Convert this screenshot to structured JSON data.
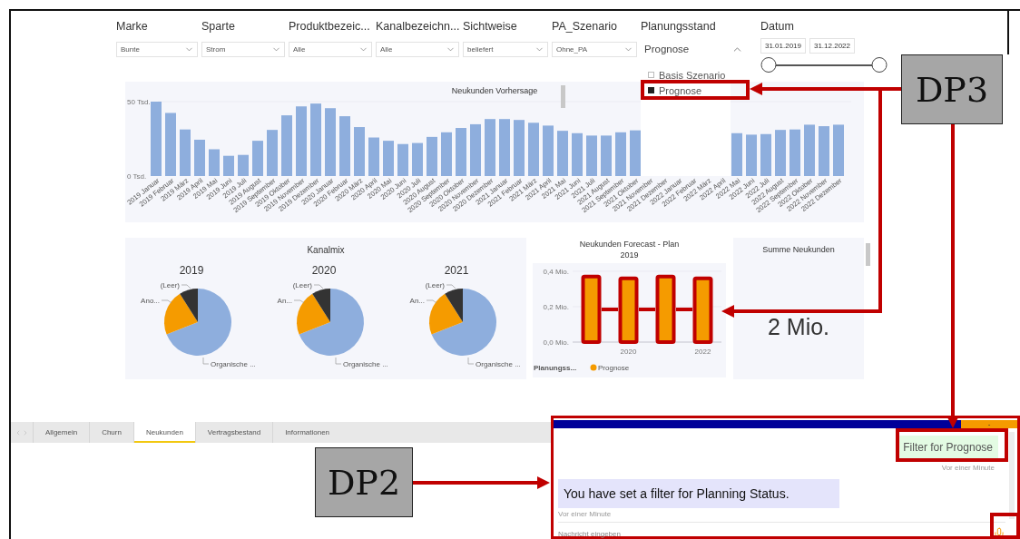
{
  "filters": [
    {
      "label": "Marke",
      "value": "Bunte"
    },
    {
      "label": "Sparte",
      "value": "Strom"
    },
    {
      "label": "Produktbezeic...",
      "value": "Alle"
    },
    {
      "label": "Kanalbezeichn...",
      "value": "Alle"
    },
    {
      "label": "Sichtweise",
      "value": "beliefert"
    },
    {
      "label": "PA_Szenario",
      "value": "Ohne_PA"
    }
  ],
  "planning_filter": {
    "label": "Planungsstand",
    "value": "Prognose",
    "expanded": true,
    "options": [
      {
        "label": "Basis Szenario",
        "checked": false
      },
      {
        "label": "Prognose",
        "checked": true
      }
    ]
  },
  "date_filter": {
    "label": "Datum",
    "start": "31.01.2019",
    "end": "31.12.2022",
    "thumbs": [
      {
        "level": 0
      },
      {
        "level": 1
      }
    ]
  },
  "trend_chart": {
    "chart_data": {
      "type": "bar",
      "title": "Neukunden Vorhersage",
      "categories": [
        "2019 Januar",
        "2019 Februar",
        "2019 März",
        "2019 April",
        "2019 Mai",
        "2019 Juni",
        "2019 Juli",
        "2019 August",
        "2019 September",
        "2019 Oktober",
        "2019 November",
        "2019 Dezember",
        "2020 Januar",
        "2020 Februar",
        "2020 März",
        "2020 April",
        "2020 Mai",
        "2020 Juni",
        "2020 Juli",
        "2020 August",
        "2020 September",
        "2020 Oktober",
        "2020 November",
        "2020 Dezember",
        "2021 Januar",
        "2021 Februar",
        "2021 März",
        "2021 April",
        "2021 Mai",
        "2021 Juni",
        "2021 Juli",
        "2021 August",
        "2021 September",
        "2021 Oktober",
        "2021 November",
        "2021 Dezember",
        "2022 Januar",
        "2022 Februar",
        "2022 März",
        "2022 April",
        "2022 Mai",
        "2022 Juni",
        "2022 Juli",
        "2022 August",
        "2022 September",
        "2022 Oktober",
        "2022 November",
        "2022 Dezember"
      ],
      "values": [
        50,
        42.4,
        31.3,
        24.4,
        18,
        13.6,
        14.2,
        23.7,
        31,
        40.8,
        46.8,
        48.7,
        45.6,
        40.2,
        32.9,
        25.9,
        23.7,
        21.5,
        22.2,
        26.3,
        29.4,
        32.3,
        34.8,
        38.3,
        38.3,
        37.7,
        35.8,
        33.9,
        30.4,
        28.8,
        27.2,
        27.2,
        29.4,
        30.7,
        null,
        null,
        null,
        null,
        null,
        null,
        28.8,
        27.8,
        28.2,
        31,
        31.3,
        34.5,
        33.5,
        34.5
      ],
      "ylim": [
        0,
        50
      ],
      "yticks": [
        {
          "value": 0,
          "label": "0 Tsd."
        },
        {
          "value": 50,
          "label": "50 Tsd."
        }
      ]
    }
  },
  "channel_mix": {
    "title": "Kanalmix",
    "pies": [
      {
        "year": "2019",
        "labels": [
          "(Leer)",
          "Ano...",
          "Organische ..."
        ]
      },
      {
        "year": "2020",
        "labels": [
          "(Leer)",
          "An...",
          "Organische ..."
        ]
      },
      {
        "year": "2021",
        "labels": [
          "(Leer)",
          "An...",
          "Organische ..."
        ]
      }
    ]
  },
  "forecast": {
    "title": "Neukunden Forecast - Plan",
    "subtitle": "2019",
    "chart_data": {
      "type": "bar",
      "x": [
        2019,
        2020,
        2021,
        2022
      ],
      "xlim": [
        2018.5,
        2022.5
      ],
      "values": [
        0.37,
        0.36,
        0.37,
        0.36
      ],
      "ylim": [
        0,
        0.4
      ],
      "yticks": [
        {
          "value": 0,
          "label": "0,0 Mio."
        },
        {
          "value": 0.2,
          "label": "0,2 Mio."
        },
        {
          "value": 0.4,
          "label": "0,4 Mio."
        }
      ],
      "xticks": [
        2020,
        2022
      ]
    },
    "legend": {
      "title": "Planungss...",
      "items": [
        {
          "label": "Prognose",
          "color": "#f59b00"
        }
      ]
    }
  },
  "total": {
    "title": "Summe Neukunden",
    "value": "2 Mio."
  },
  "tabs": [
    {
      "label": "Allgemein",
      "selected": false
    },
    {
      "label": "Churn",
      "selected": false
    },
    {
      "label": "Neukunden",
      "selected": true
    },
    {
      "label": "Vertragsbestand",
      "selected": false
    },
    {
      "label": "Informationen",
      "selected": false
    }
  ],
  "chat": {
    "header_button": "-",
    "messages": [
      {
        "kind": "sent",
        "text": "Filter for Prognose",
        "time": "Vor einer Minute"
      },
      {
        "kind": "received",
        "text": "You have set a filter for Planning Status.",
        "time": "Vor einer Minute"
      }
    ],
    "input": {
      "placeholder": "Nachricht eingeben"
    }
  },
  "annotations": [
    {
      "label": "DP3"
    },
    {
      "label": "DP2"
    }
  ]
}
